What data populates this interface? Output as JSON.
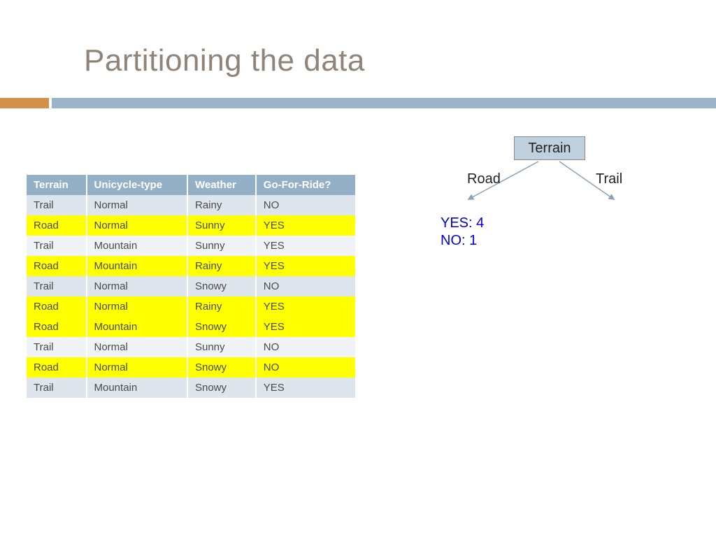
{
  "title": "Partitioning the data",
  "table": {
    "headers": [
      "Terrain",
      "Unicycle-type",
      "Weather",
      "Go-For-Ride?"
    ],
    "rows": [
      {
        "cells": [
          "Trail",
          "Normal",
          "Rainy",
          "NO"
        ],
        "hl": false
      },
      {
        "cells": [
          "Road",
          "Normal",
          "Sunny",
          "YES"
        ],
        "hl": true
      },
      {
        "cells": [
          "Trail",
          "Mountain",
          "Sunny",
          "YES"
        ],
        "hl": false
      },
      {
        "cells": [
          "Road",
          "Mountain",
          "Rainy",
          "YES"
        ],
        "hl": true
      },
      {
        "cells": [
          "Trail",
          "Normal",
          "Snowy",
          "NO"
        ],
        "hl": false
      },
      {
        "cells": [
          "Road",
          "Normal",
          "Rainy",
          "YES"
        ],
        "hl": true
      },
      {
        "cells": [
          "Road",
          "Mountain",
          "Snowy",
          "YES"
        ],
        "hl": true
      },
      {
        "cells": [
          "Trail",
          "Normal",
          "Sunny",
          "NO"
        ],
        "hl": false
      },
      {
        "cells": [
          "Road",
          "Normal",
          "Snowy",
          "NO"
        ],
        "hl": true
      },
      {
        "cells": [
          "Trail",
          "Mountain",
          "Snowy",
          "YES"
        ],
        "hl": false
      }
    ]
  },
  "tree": {
    "root": "Terrain",
    "left_label": "Road",
    "right_label": "Trail",
    "left_result_yes": "YES: 4",
    "left_result_no": "NO: 1"
  },
  "colors": {
    "title": "#8f8477",
    "accent_orange": "#d59148",
    "accent_blue": "#9ab5cb",
    "header_bg": "#94b0c7",
    "row_highlight": "#ffff00",
    "result_text": "#0000e0"
  }
}
